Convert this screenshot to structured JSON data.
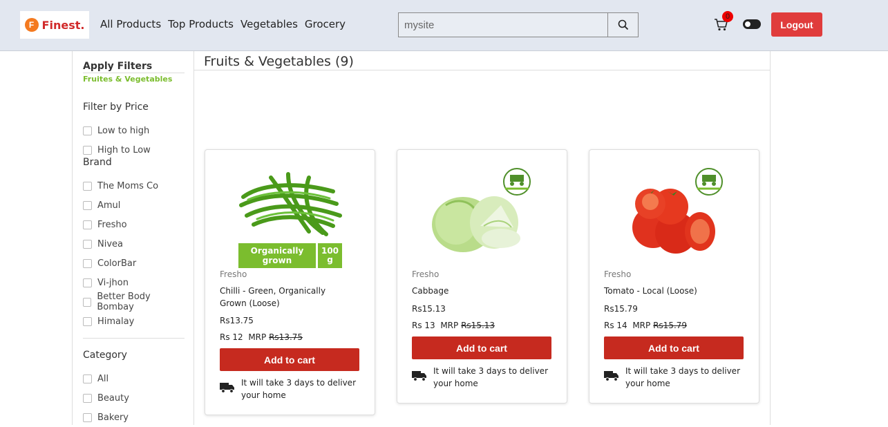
{
  "header": {
    "logo_letter": "F",
    "logo_text": "Finest.",
    "nav": [
      "All Products",
      "Top Products",
      "Vegetables",
      "Grocery"
    ],
    "search_value": "mysite",
    "cart_count": "0",
    "logout_label": "Logout"
  },
  "sidebar": {
    "apply_filters": "Apply Filters",
    "active_filter": "Fruites & Vegetables",
    "price_title": "Filter by Price",
    "price_options": [
      "Low to high",
      "High to Low"
    ],
    "brand_title": "Brand",
    "brands": [
      "The Moms Co",
      "Amul",
      "Fresho",
      "Nivea",
      "ColorBar",
      "Vi-jhon",
      "Better Body Bombay",
      "Himalay"
    ],
    "category_title": "Category",
    "categories": [
      "All",
      "Beauty",
      "Bakery"
    ]
  },
  "main": {
    "title": "Fruits & Vegetables (9)",
    "products": [
      {
        "brand": "Fresho",
        "name": "Chilli - Green, Organically Grown (Loose)",
        "price": "Rs13.75",
        "sale": "Rs 12",
        "mrp_label": "MRP",
        "mrp": "Rs13.75",
        "badge": "Organically grown",
        "badge_qty": "100 g",
        "add_label": "Add to cart",
        "delivery": "It will take 3 days to deliver your home"
      },
      {
        "brand": "Fresho",
        "name": "Cabbage",
        "price": "Rs15.13",
        "sale": "Rs 13",
        "mrp_label": "MRP",
        "mrp": "Rs15.13",
        "add_label": "Add to cart",
        "delivery": "It will take 3 days to deliver your home"
      },
      {
        "brand": "Fresho",
        "name": "Tomato - Local (Loose)",
        "price": "Rs15.79",
        "sale": "Rs 14",
        "mrp_label": "MRP",
        "mrp": "Rs15.79",
        "add_label": "Add to cart",
        "delivery": "It will take 3 days to deliver your home"
      }
    ]
  },
  "colors": {
    "header_bg": "#e2e7f0",
    "accent_green": "#7bbd2e",
    "add_button": "#c62a1f",
    "logout_button": "#e03c3c"
  },
  "icons": [
    "search-icon",
    "cart-icon",
    "theme-toggle-icon",
    "truck-icon",
    "farmer-partnership-icon"
  ]
}
